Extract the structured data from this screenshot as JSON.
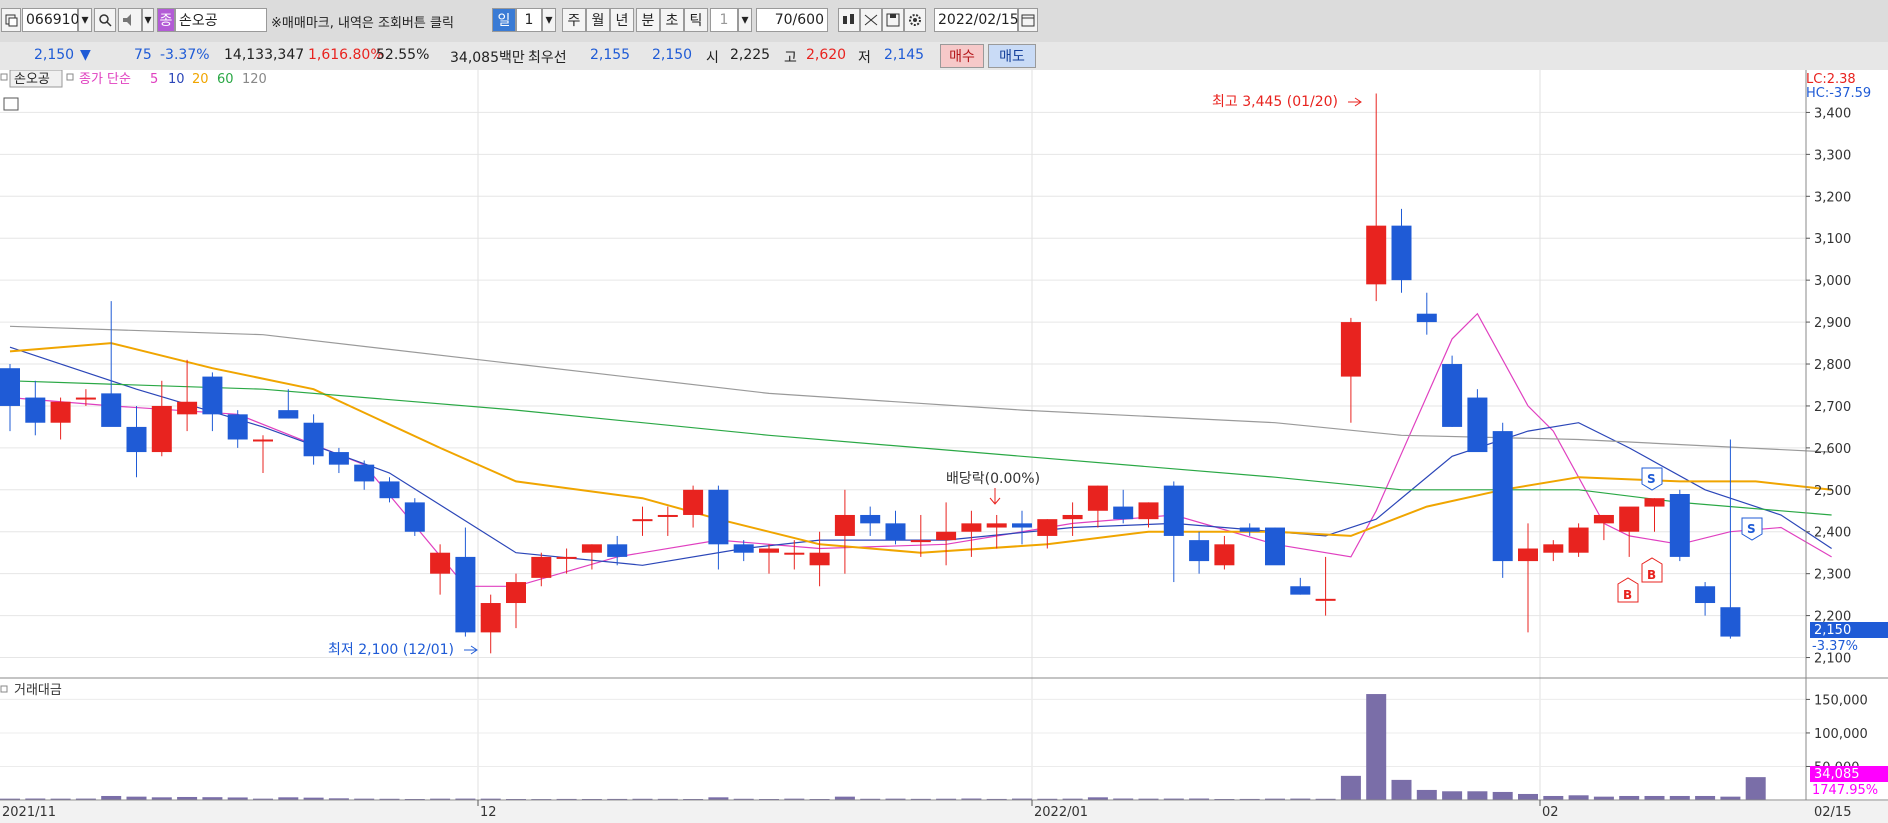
{
  "toolbar": {
    "code": "066910",
    "type_badge": "종",
    "stock_name": "손오공",
    "notice": "※매매마크, 내역은 조회버튼 클릭",
    "period_day": "일",
    "period_num": "1",
    "period_week": "주",
    "period_month": "월",
    "period_year": "년",
    "period_min": "분",
    "period_sec": "초",
    "period_tick": "틱",
    "unit_value": "1",
    "count_value": "70/600",
    "date_value": "2022/02/15"
  },
  "quote": {
    "price": "2,150",
    "change": "75",
    "change_pct": "-3.37%",
    "volume": "14,133,347",
    "volume_pct": "1,616.80%",
    "turnover_pct": "52.55%",
    "trade_value": "34,085백만",
    "best_ask_label": "최우선",
    "best_ask": "2,155",
    "best_bid": "2,150",
    "open_label": "시",
    "open": "2,225",
    "high_label": "고",
    "high": "2,620",
    "low_label": "저",
    "low": "2,145",
    "buy_button": "매수",
    "sell_button": "매도"
  },
  "colors": {
    "up": "#e8231f",
    "down": "#1f5bd6",
    "ma5": "#e040c0",
    "ma10": "#2b46b8",
    "ma20": "#f0a500",
    "ma60": "#2aa845",
    "ma120": "#9a9a9a",
    "volume": "#7a6ea8",
    "highlight": "#ff00ff"
  },
  "chart_data": {
    "type": "candlestick",
    "legend": {
      "name": "손오공",
      "base": "종가 단순",
      "periods": [
        "5",
        "10",
        "20",
        "60",
        "120"
      ]
    },
    "right_labels": {
      "lc": "LC:2.38",
      "hc": "HC:-37.59",
      "last_price": "2,150",
      "last_pct": "-3.37%"
    },
    "y_ticks": [
      2100,
      2200,
      2300,
      2400,
      2500,
      2600,
      2700,
      2800,
      2900,
      3000,
      3100,
      3200,
      3300,
      3400
    ],
    "y_tick_labels": [
      "2,100",
      "2,200",
      "2,300",
      "2,400",
      "2,500",
      "2,600",
      "2,700",
      "2,800",
      "2,900",
      "3,000",
      "3,100",
      "3,200",
      "3,300",
      "3,400"
    ],
    "x_labels": [
      "2021/11",
      "12",
      "2022/01",
      "02",
      "02/15"
    ],
    "annotations": {
      "high": "최고 3,445 (01/20)",
      "low": "최저 2,100 (12/01)",
      "dividend": "배당락(0.00%)"
    },
    "candles": [
      [
        2790,
        2800,
        2640,
        2700
      ],
      [
        2720,
        2760,
        2630,
        2660
      ],
      [
        2660,
        2720,
        2620,
        2710
      ],
      [
        2720,
        2740,
        2700,
        2720
      ],
      [
        2730,
        2950,
        2680,
        2650
      ],
      [
        2650,
        2700,
        2530,
        2590
      ],
      [
        2590,
        2760,
        2580,
        2700
      ],
      [
        2680,
        2810,
        2640,
        2710
      ],
      [
        2770,
        2780,
        2640,
        2680
      ],
      [
        2680,
        2690,
        2600,
        2620
      ],
      [
        2620,
        2630,
        2540,
        2620
      ],
      [
        2690,
        2740,
        2670,
        2670
      ],
      [
        2660,
        2680,
        2560,
        2580
      ],
      [
        2590,
        2600,
        2540,
        2560
      ],
      [
        2560,
        2570,
        2500,
        2520
      ],
      [
        2520,
        2530,
        2470,
        2480
      ],
      [
        2470,
        2480,
        2390,
        2400
      ],
      [
        2300,
        2370,
        2250,
        2350
      ],
      [
        2340,
        2410,
        2150,
        2160
      ],
      [
        2160,
        2250,
        2110,
        2230
      ],
      [
        2230,
        2300,
        2170,
        2280
      ],
      [
        2290,
        2350,
        2270,
        2340
      ],
      [
        2340,
        2360,
        2300,
        2340
      ],
      [
        2350,
        2370,
        2310,
        2370
      ],
      [
        2370,
        2390,
        2320,
        2340
      ],
      [
        2430,
        2460,
        2390,
        2430
      ],
      [
        2440,
        2460,
        2390,
        2440
      ],
      [
        2440,
        2510,
        2410,
        2500
      ],
      [
        2500,
        2510,
        2310,
        2370
      ],
      [
        2370,
        2380,
        2330,
        2350
      ],
      [
        2350,
        2370,
        2300,
        2360
      ],
      [
        2350,
        2380,
        2310,
        2350
      ],
      [
        2320,
        2400,
        2270,
        2350
      ],
      [
        2390,
        2500,
        2300,
        2440
      ],
      [
        2440,
        2460,
        2390,
        2420
      ],
      [
        2420,
        2450,
        2370,
        2380
      ],
      [
        2380,
        2440,
        2340,
        2380
      ],
      [
        2380,
        2470,
        2320,
        2400
      ],
      [
        2400,
        2450,
        2340,
        2420
      ],
      [
        2410,
        2440,
        2360,
        2420
      ],
      [
        2420,
        2450,
        2370,
        2410
      ],
      [
        2390,
        2430,
        2360,
        2430
      ],
      [
        2430,
        2470,
        2390,
        2440
      ],
      [
        2450,
        2510,
        2410,
        2510
      ],
      [
        2460,
        2500,
        2420,
        2430
      ],
      [
        2430,
        2470,
        2410,
        2470
      ],
      [
        2510,
        2520,
        2280,
        2390
      ],
      [
        2380,
        2400,
        2300,
        2330
      ],
      [
        2320,
        2390,
        2310,
        2370
      ],
      [
        2410,
        2420,
        2390,
        2400
      ],
      [
        2410,
        2410,
        2330,
        2320
      ],
      [
        2270,
        2290,
        2250,
        2250
      ],
      [
        2240,
        2340,
        2200,
        2240
      ],
      [
        2770,
        2910,
        2660,
        2900
      ],
      [
        2990,
        3445,
        2950,
        3130
      ],
      [
        3130,
        3170,
        2970,
        3000
      ],
      [
        2920,
        2970,
        2870,
        2900
      ],
      [
        2800,
        2820,
        2650,
        2650
      ],
      [
        2720,
        2740,
        2600,
        2590
      ],
      [
        2640,
        2660,
        2290,
        2330
      ],
      [
        2330,
        2420,
        2160,
        2360
      ],
      [
        2350,
        2380,
        2330,
        2370
      ],
      [
        2350,
        2420,
        2340,
        2410
      ],
      [
        2420,
        2440,
        2380,
        2440
      ],
      [
        2400,
        2440,
        2340,
        2460
      ],
      [
        2460,
        2480,
        2400,
        2480
      ],
      [
        2490,
        2500,
        2330,
        2340
      ],
      [
        2270,
        2280,
        2200,
        2230
      ],
      [
        2220,
        2620,
        2145,
        2150
      ]
    ],
    "ma": {
      "5": [
        [
          0,
          2720
        ],
        [
          4,
          2700
        ],
        [
          9,
          2680
        ],
        [
          14,
          2560
        ],
        [
          18,
          2270
        ],
        [
          20,
          2270
        ],
        [
          24,
          2340
        ],
        [
          28,
          2380
        ],
        [
          32,
          2360
        ],
        [
          37,
          2370
        ],
        [
          42,
          2420
        ],
        [
          46,
          2440
        ],
        [
          50,
          2370
        ],
        [
          53,
          2340
        ],
        [
          54,
          2450
        ],
        [
          57,
          2860
        ],
        [
          58,
          2920
        ],
        [
          60,
          2700
        ],
        [
          61,
          2640
        ],
        [
          63,
          2420
        ],
        [
          64,
          2390
        ],
        [
          66,
          2370
        ],
        [
          68,
          2400
        ],
        [
          70,
          2410
        ],
        [
          72,
          2340
        ]
      ],
      "10": [
        [
          0,
          2840
        ],
        [
          5,
          2740
        ],
        [
          10,
          2650
        ],
        [
          15,
          2540
        ],
        [
          20,
          2350
        ],
        [
          25,
          2320
        ],
        [
          29,
          2360
        ],
        [
          32,
          2380
        ],
        [
          37,
          2380
        ],
        [
          42,
          2410
        ],
        [
          46,
          2420
        ],
        [
          52,
          2390
        ],
        [
          54,
          2430
        ],
        [
          57,
          2580
        ],
        [
          60,
          2640
        ],
        [
          62,
          2660
        ],
        [
          64,
          2600
        ],
        [
          67,
          2500
        ],
        [
          70,
          2440
        ],
        [
          72,
          2360
        ]
      ],
      "20": [
        [
          0,
          2830
        ],
        [
          4,
          2850
        ],
        [
          8,
          2790
        ],
        [
          12,
          2740
        ],
        [
          17,
          2600
        ],
        [
          20,
          2520
        ],
        [
          25,
          2480
        ],
        [
          28,
          2430
        ],
        [
          32,
          2370
        ],
        [
          36,
          2350
        ],
        [
          41,
          2370
        ],
        [
          45,
          2400
        ],
        [
          50,
          2400
        ],
        [
          53,
          2390
        ],
        [
          56,
          2460
        ],
        [
          59,
          2500
        ],
        [
          62,
          2530
        ],
        [
          66,
          2520
        ],
        [
          69,
          2520
        ],
        [
          72,
          2500
        ]
      ],
      "60": [
        [
          0,
          2760
        ],
        [
          10,
          2740
        ],
        [
          20,
          2690
        ],
        [
          30,
          2630
        ],
        [
          40,
          2580
        ],
        [
          50,
          2530
        ],
        [
          55,
          2500
        ],
        [
          62,
          2500
        ],
        [
          66,
          2470
        ],
        [
          72,
          2440
        ]
      ],
      "120": [
        [
          0,
          2890
        ],
        [
          10,
          2870
        ],
        [
          20,
          2800
        ],
        [
          30,
          2730
        ],
        [
          40,
          2690
        ],
        [
          50,
          2660
        ],
        [
          55,
          2630
        ],
        [
          62,
          2620
        ],
        [
          72,
          2590
        ]
      ]
    },
    "volume": {
      "label": "거래대금",
      "y_tick_labels": [
        "150,000",
        "100,000",
        "50,000"
      ],
      "y_ticks": [
        150000,
        100000,
        50000
      ],
      "last_value": "34,085",
      "last_pct": "1747.95%",
      "values": [
        2000,
        2200,
        2000,
        2100,
        6000,
        5000,
        4000,
        4500,
        4200,
        3800,
        2000,
        4000,
        3500,
        2500,
        2000,
        1800,
        1500,
        2000,
        2100,
        2000,
        1500,
        1400,
        1600,
        1500,
        1600,
        1800,
        1700,
        1500,
        4000,
        1800,
        1500,
        2000,
        1500,
        5000,
        1800,
        2000,
        1700,
        1900,
        2200,
        1600,
        2100,
        1800,
        2000,
        4000,
        2200,
        2000,
        2100,
        2200,
        1500,
        1600,
        2000,
        2100,
        1800,
        36000,
        158000,
        30000,
        15000,
        13000,
        13000,
        12000,
        9000,
        6000,
        7000,
        5000,
        6000,
        6000,
        6000,
        6000,
        5000,
        34085
      ]
    }
  }
}
